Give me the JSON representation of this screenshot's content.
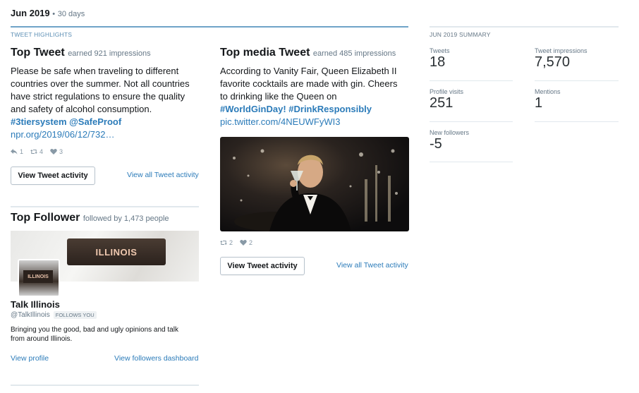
{
  "header": {
    "month": "Jun 2019",
    "separator": "•",
    "period": "30 days"
  },
  "highlights": {
    "section_label": "TWEET HIGHLIGHTS",
    "top_tweet": {
      "title": "Top Tweet",
      "note": "earned 921 impressions",
      "text_lines": [
        "Please be safe when traveling to different",
        "countries over the summer. Not all countries",
        "have strict regulations to ensure the quality",
        "and safety of alcohol consumption."
      ],
      "hashtags": "#3tiersystem @SafeProof",
      "url": "npr.org/2019/06/12/732…",
      "replies": "1",
      "retweets": "4",
      "likes": "3",
      "button_label": "View Tweet activity",
      "link_label": "View all Tweet activity"
    },
    "top_media_tweet": {
      "title": "Top media Tweet",
      "note": "earned 485 impressions",
      "text_lines": [
        "According to Vanity Fair, Queen Elizabeth II",
        "favorite cocktails are made with gin. Cheers",
        "to drinking like the Queen on"
      ],
      "hashtags": "#WorldGinDay! #DrinkResponsibly",
      "url": "pic.twitter.com/4NEUWFyWI3",
      "retweets": "2",
      "likes": "2",
      "button_label": "View Tweet activity",
      "link_label": "View all Tweet activity"
    },
    "top_follower": {
      "title": "Top Follower",
      "note": "followed by 1,473 people",
      "banner_text": "ILLINOIS",
      "avatar_text": "ILLINOIS",
      "name": "Talk Illinois",
      "handle": "@TalkIllinois",
      "badge": "FOLLOWS YOU",
      "bio_lines": [
        "Bringing you the good, bad and ugly opinions and talk",
        "from around Illinois."
      ],
      "profile_link": "View profile",
      "dashboard_link": "View followers dashboard"
    }
  },
  "summary": {
    "section_label": "JUN 2019 SUMMARY",
    "items": [
      {
        "label": "Tweets",
        "value": "18"
      },
      {
        "label": "Tweet impressions",
        "value": "7,570"
      },
      {
        "label": "Profile visits",
        "value": "251"
      },
      {
        "label": "Mentions",
        "value": "1"
      },
      {
        "label": "New followers",
        "value": "-5"
      }
    ]
  },
  "colors": {
    "accent": "#1b95e0",
    "link": "#2b7bb9",
    "rule_blue": "#6fa3c8"
  }
}
